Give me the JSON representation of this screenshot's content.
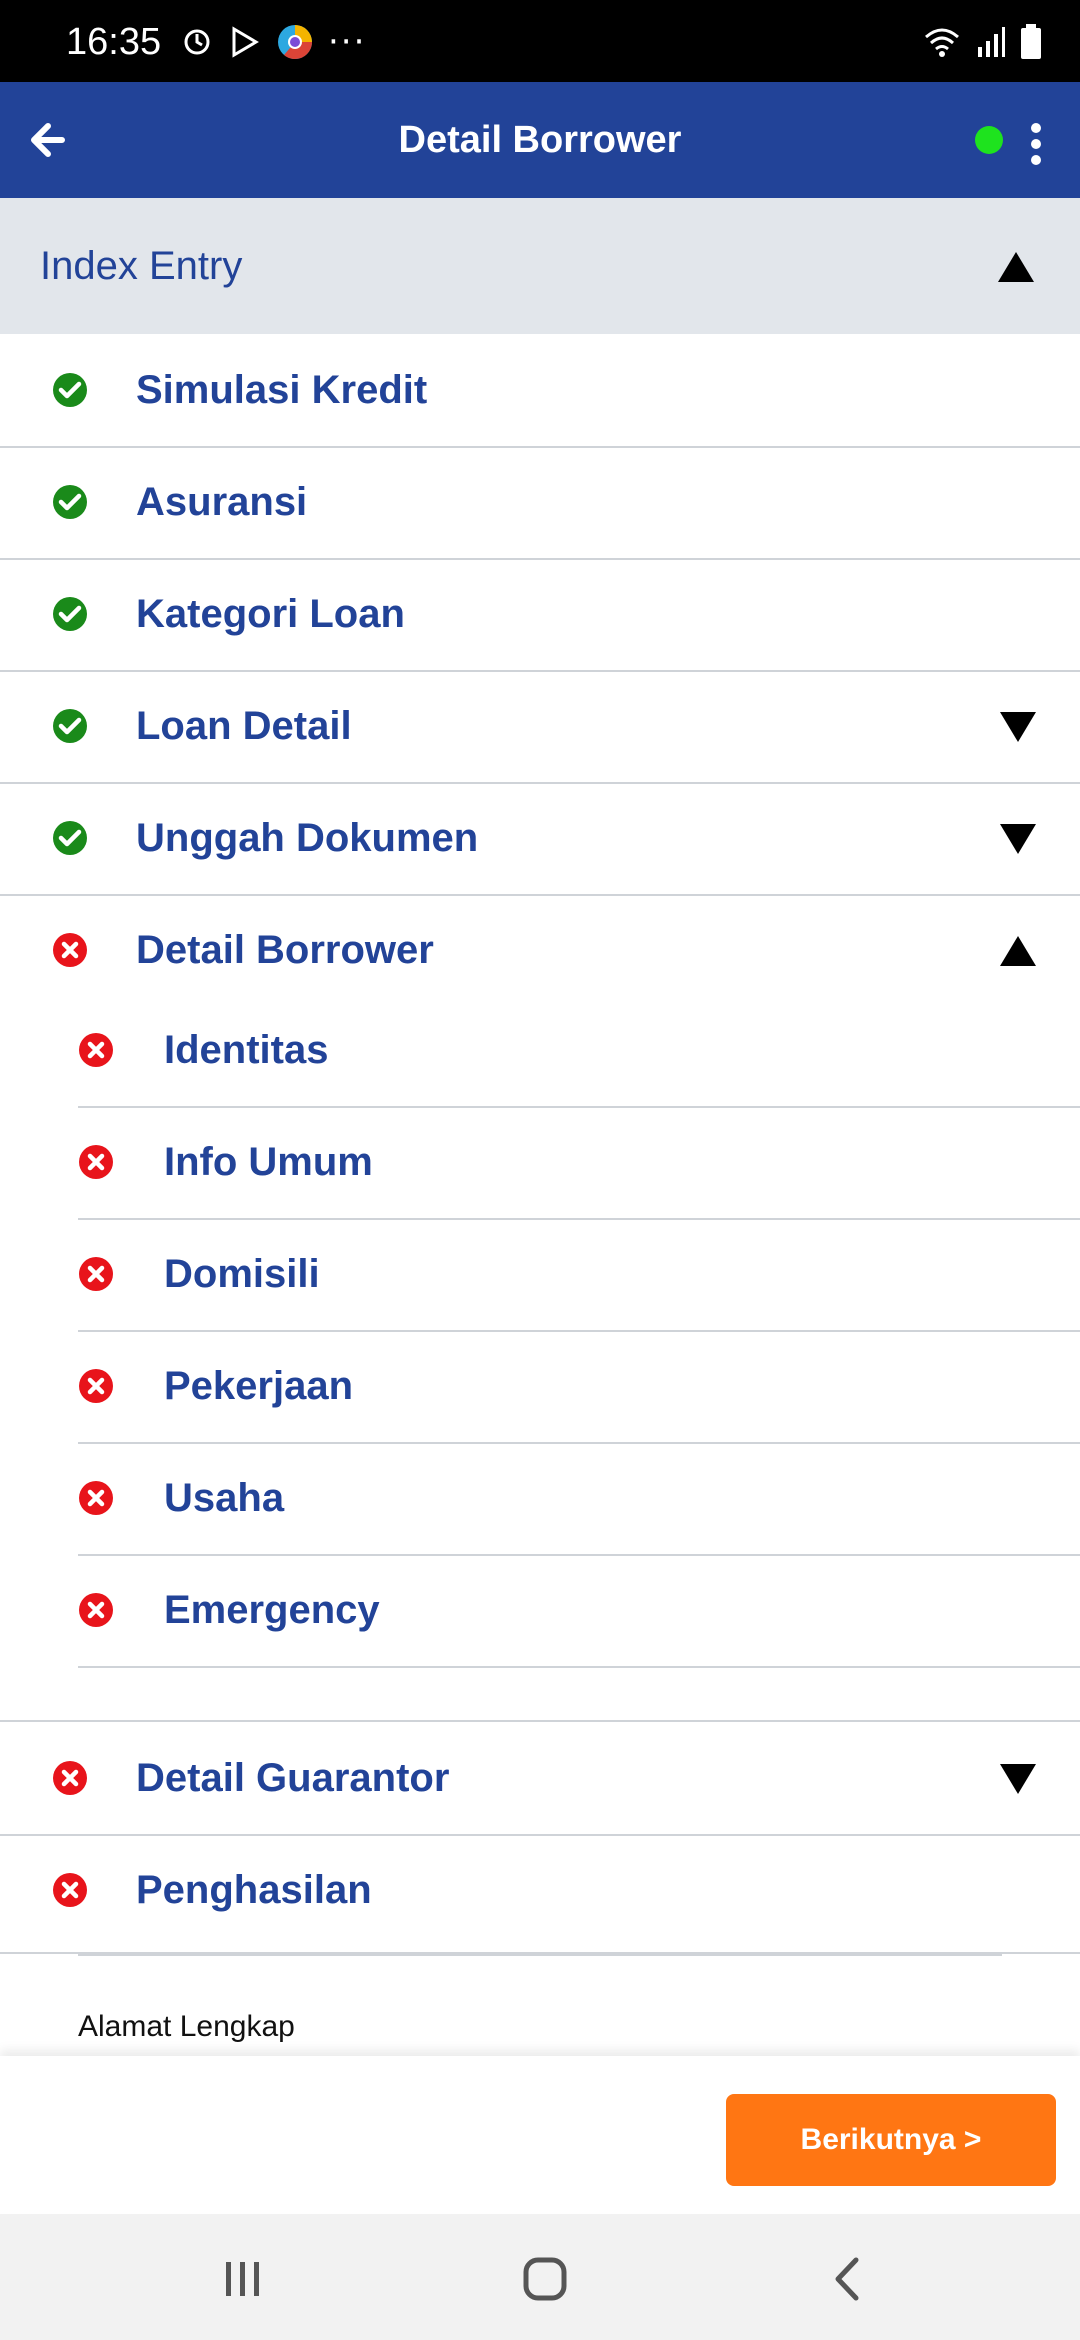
{
  "status_bar": {
    "time": "16:35",
    "more": "···"
  },
  "app_bar": {
    "title": "Detail Borrower",
    "online_color": "#1ee31e"
  },
  "section": {
    "title": "Index Entry"
  },
  "colors": {
    "primary": "#224398",
    "success": "#1a8a1a",
    "error": "#e8141b",
    "accent": "#ff7613"
  },
  "items": [
    {
      "label": "Simulasi Kredit",
      "status": "complete"
    },
    {
      "label": "Asuransi",
      "status": "complete"
    },
    {
      "label": "Kategori Loan",
      "status": "complete"
    },
    {
      "label": "Loan Detail",
      "status": "complete",
      "expandable": "collapsed"
    },
    {
      "label": "Unggah Dokumen",
      "status": "complete",
      "expandable": "collapsed"
    },
    {
      "label": "Detail Borrower",
      "status": "incomplete",
      "expandable": "expanded"
    }
  ],
  "borrower_subitems": [
    {
      "label": "Identitas",
      "status": "incomplete"
    },
    {
      "label": "Info Umum",
      "status": "incomplete"
    },
    {
      "label": "Domisili",
      "status": "incomplete"
    },
    {
      "label": "Pekerjaan",
      "status": "incomplete"
    },
    {
      "label": "Usaha",
      "status": "incomplete"
    },
    {
      "label": "Emergency",
      "status": "incomplete"
    }
  ],
  "items_after": [
    {
      "label": "Detail Guarantor",
      "status": "incomplete",
      "expandable": "collapsed"
    },
    {
      "label": "Penghasilan",
      "status": "incomplete"
    }
  ],
  "form": {
    "field_label": "Alamat Lengkap"
  },
  "actions": {
    "next_label": "Berikutnya >"
  }
}
